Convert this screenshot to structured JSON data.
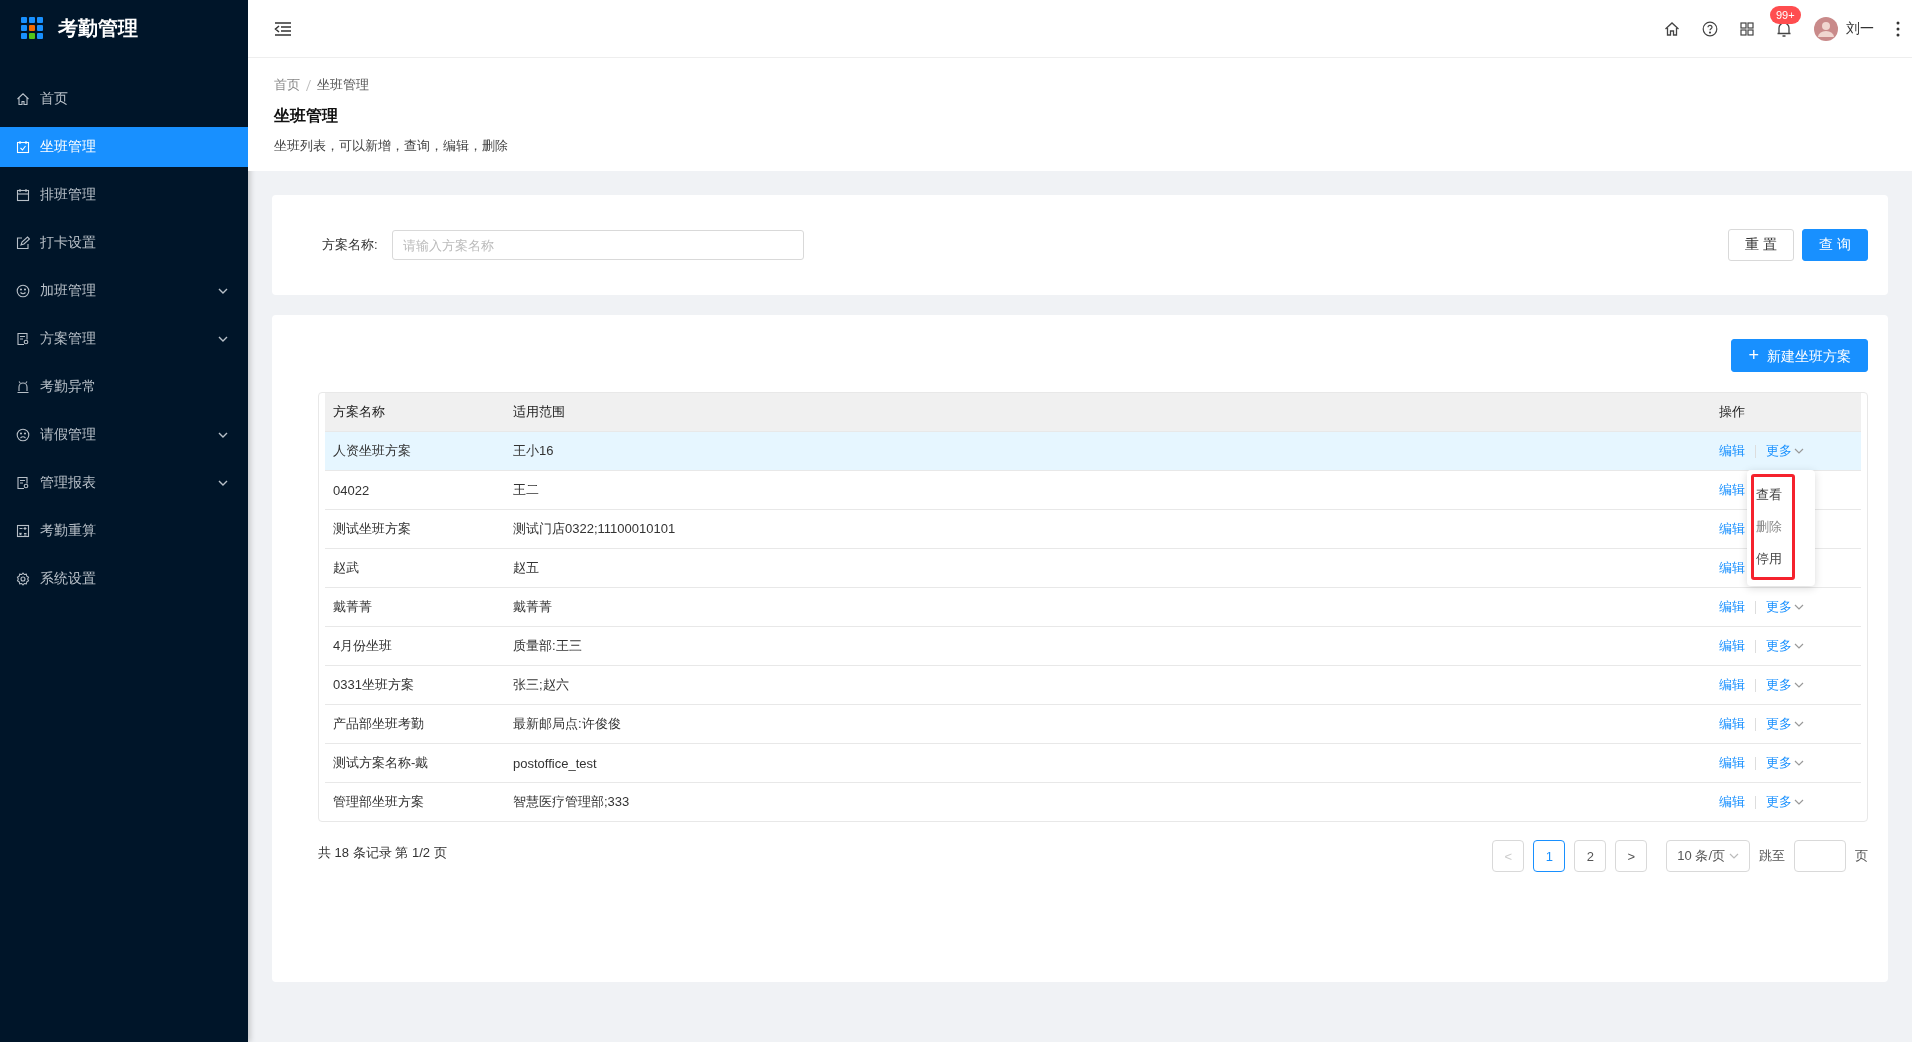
{
  "app": {
    "title": "考勤管理"
  },
  "sidebar": {
    "items": [
      {
        "label": "首页",
        "kind": "link",
        "selected": false
      },
      {
        "label": "坐班管理",
        "kind": "link",
        "selected": true
      },
      {
        "label": "排班管理",
        "kind": "link",
        "selected": false
      },
      {
        "label": "打卡设置",
        "kind": "link",
        "selected": false
      },
      {
        "label": "加班管理",
        "kind": "group",
        "selected": false
      },
      {
        "label": "方案管理",
        "kind": "group",
        "selected": false
      },
      {
        "label": "考勤异常",
        "kind": "link",
        "selected": false
      },
      {
        "label": "请假管理",
        "kind": "group",
        "selected": false
      },
      {
        "label": "管理报表",
        "kind": "group",
        "selected": false
      },
      {
        "label": "考勤重算",
        "kind": "link",
        "selected": false
      },
      {
        "label": "系统设置",
        "kind": "link",
        "selected": false
      }
    ]
  },
  "header": {
    "notification_badge": "99+",
    "user_name": "刘一"
  },
  "breadcrumb": [
    "首页",
    "坐班管理"
  ],
  "page": {
    "title": "坐班管理",
    "description": "坐班列表，可以新增，查询，编辑，删除"
  },
  "search": {
    "label": "方案名称:",
    "placeholder": "请输入方案名称",
    "buttons": [
      "重 置",
      "查 询"
    ]
  },
  "new_button": {
    "icon": "+",
    "label": "新建坐班方案"
  },
  "table": {
    "columns": [
      "方案名称",
      "适用范围",
      "操作"
    ],
    "rows": [
      {
        "name": "人资坐班方案",
        "scope": "王小16",
        "edit": "编辑",
        "more": "更多",
        "selected": true
      },
      {
        "name": "04022",
        "scope": "王二",
        "edit": "编辑",
        "selected": false
      },
      {
        "name": "测试坐班方案",
        "scope": "测试门店0322;11100010101",
        "edit": "编辑",
        "selected": false
      },
      {
        "name": "赵武",
        "scope": "赵五",
        "edit": "编辑",
        "selected": false
      },
      {
        "name": "戴菁菁",
        "scope": "戴菁菁",
        "edit": "编辑",
        "more": "更多",
        "selected": false
      },
      {
        "name": "4月份坐班",
        "scope": "质量部:王三",
        "edit": "编辑",
        "more": "更多",
        "selected": false
      },
      {
        "name": "0331坐班方案",
        "scope": "张三;赵六",
        "edit": "编辑",
        "more": "更多",
        "selected": false
      },
      {
        "name": "产品部坐班考勤",
        "scope": "最新邮局点:许俊俊",
        "edit": "编辑",
        "more": "更多",
        "selected": false
      },
      {
        "name": "测试方案名称-戴",
        "scope": "postoffice_test",
        "edit": "编辑",
        "more": "更多",
        "selected": false
      },
      {
        "name": "管理部坐班方案",
        "scope": "智慧医疗管理部;333",
        "edit": "编辑",
        "more": "更多",
        "selected": false
      }
    ]
  },
  "dropdown": {
    "items": [
      "查看",
      "删除",
      "停用"
    ]
  },
  "pagination": {
    "summary": "共 18 条记录 第 1/2 页",
    "prev": "<",
    "next": ">",
    "pages": [
      {
        "label": "1",
        "selected": true
      },
      {
        "label": "2",
        "selected": false
      }
    ],
    "page_size": "10 条/页",
    "jump_label": "跳至",
    "page_suffix": "页"
  }
}
